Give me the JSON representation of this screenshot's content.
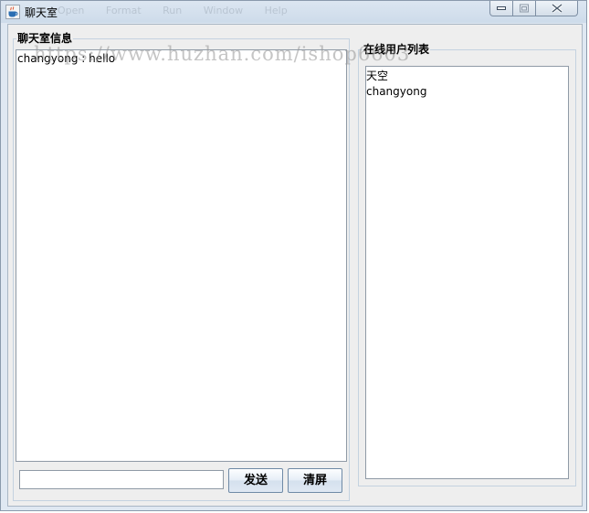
{
  "window": {
    "title": "聊天室",
    "ghost_menu": [
      "Open",
      "Format",
      "Run",
      "Window",
      "Help"
    ],
    "controls": {
      "minimize": "minimize",
      "maximize": "maximize",
      "close": "close"
    }
  },
  "chat_panel": {
    "title": "聊天室信息",
    "messages": [
      "changyong : hello"
    ],
    "input_value": "",
    "send_label": "发送",
    "clear_label": "清屏"
  },
  "users_panel": {
    "title": "在线用户列表",
    "users": [
      "天空",
      "changyong"
    ]
  },
  "watermark": "https://www.huzhan.com/ishop6603",
  "colors": {
    "titlebar": "#dce6f1",
    "client_bg": "#eeeeee",
    "group_border": "#c4d2e0",
    "button_border": "#6f8aa6"
  }
}
